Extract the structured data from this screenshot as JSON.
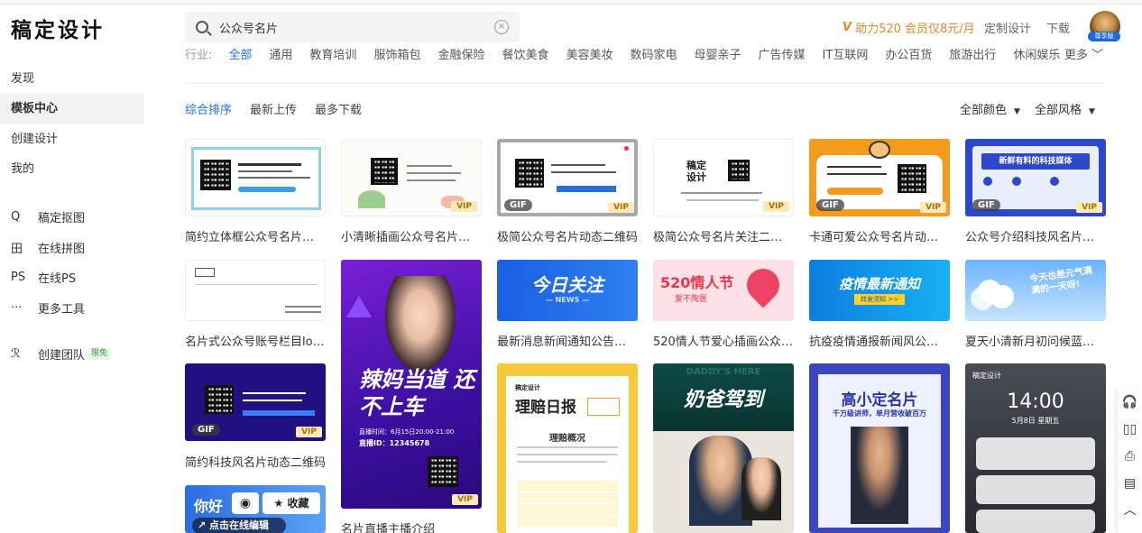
{
  "app": {
    "logo": "稿定设计"
  },
  "search": {
    "value": "公众号名片",
    "clear_icon": "×"
  },
  "header": {
    "promo": "助力520 会员仅8元/月",
    "custom_design": "定制设计",
    "download": "下载",
    "avatar_badge": "尊享版"
  },
  "industry": {
    "label": "行业:",
    "items": [
      "全部",
      "通用",
      "教育培训",
      "服饰箱包",
      "金融保险",
      "餐饮美食",
      "美容美妆",
      "数码家电",
      "母婴亲子",
      "广告传媒",
      "IT互联网",
      "办公百货",
      "旅游出行",
      "休闲娱乐"
    ],
    "more": "更多"
  },
  "sidebar": {
    "items": [
      "发现",
      "模板中心",
      "创建设计",
      "我的"
    ],
    "tools": [
      {
        "icon": "Q",
        "label": "稿定抠图"
      },
      {
        "icon": "田",
        "label": "在线拼图"
      },
      {
        "icon": "PS",
        "label": "在线PS"
      },
      {
        "icon": "···",
        "label": "更多工具"
      },
      {
        "icon": "ℛ",
        "label": "创建团队",
        "badge": "限免"
      }
    ]
  },
  "sort": {
    "items": [
      "综合排序",
      "最新上传",
      "最多下载"
    ]
  },
  "filters": {
    "color": "全部颜色",
    "style": "全部风格"
  },
  "cards": {
    "row1": [
      "简约立体框公众号名片关注...",
      "小清晰插画公众号名片关注...",
      "极简公众号名片动态二维码",
      "极简公众号名片关注二维码...",
      "卡通可爱公众号名片动态二...",
      "公众号介绍科技风名片动态..."
    ],
    "row2": [
      "名片式公众号账号栏目logo",
      "最新消息新闻通知公告公众...",
      "520情人节爱心插画公众号...",
      "抗疫疫情通报新闻风公众号...",
      "夏天小清新月初问候蓝天公..."
    ],
    "row3": [
      "简约科技风名片动态二维码"
    ],
    "tall_caption": "名片直播主播介绍",
    "badges": {
      "vip": "VIP",
      "gif": "GIF"
    },
    "banners": {
      "follow_today": "今日关注",
      "news": "— NEWS —",
      "love520": "520情人节",
      "love_sub": "爱不陶医",
      "epidemic": "疫情最新通知",
      "epidemic_sub": "转发须知 >>",
      "summer": "今天也是元气满满的一天呀!",
      "mom": "辣妈当道 还不上车",
      "mom_time": "直播时间：6月15日20:00-21:00",
      "mom_id": "直播ID：12345678",
      "daily": "理赔日报",
      "daily_sub": "理赔概况",
      "dad": "奶爸驾到",
      "dad_en": "DADDY'S HERE",
      "card_name": "高小定名片",
      "card_sub": "千万级讲师，单月营收破百万",
      "time": "14:00",
      "date": "5月8日 星期五",
      "logo_small": "稿定设计",
      "media": "新鲜有料的科技媒体",
      "collect": "收藏",
      "edit": "↗ 点击在线编辑",
      "hello": "你好"
    }
  },
  "float": [
    "🎧",
    "▯▯",
    "⎙",
    "▤",
    "︿"
  ]
}
